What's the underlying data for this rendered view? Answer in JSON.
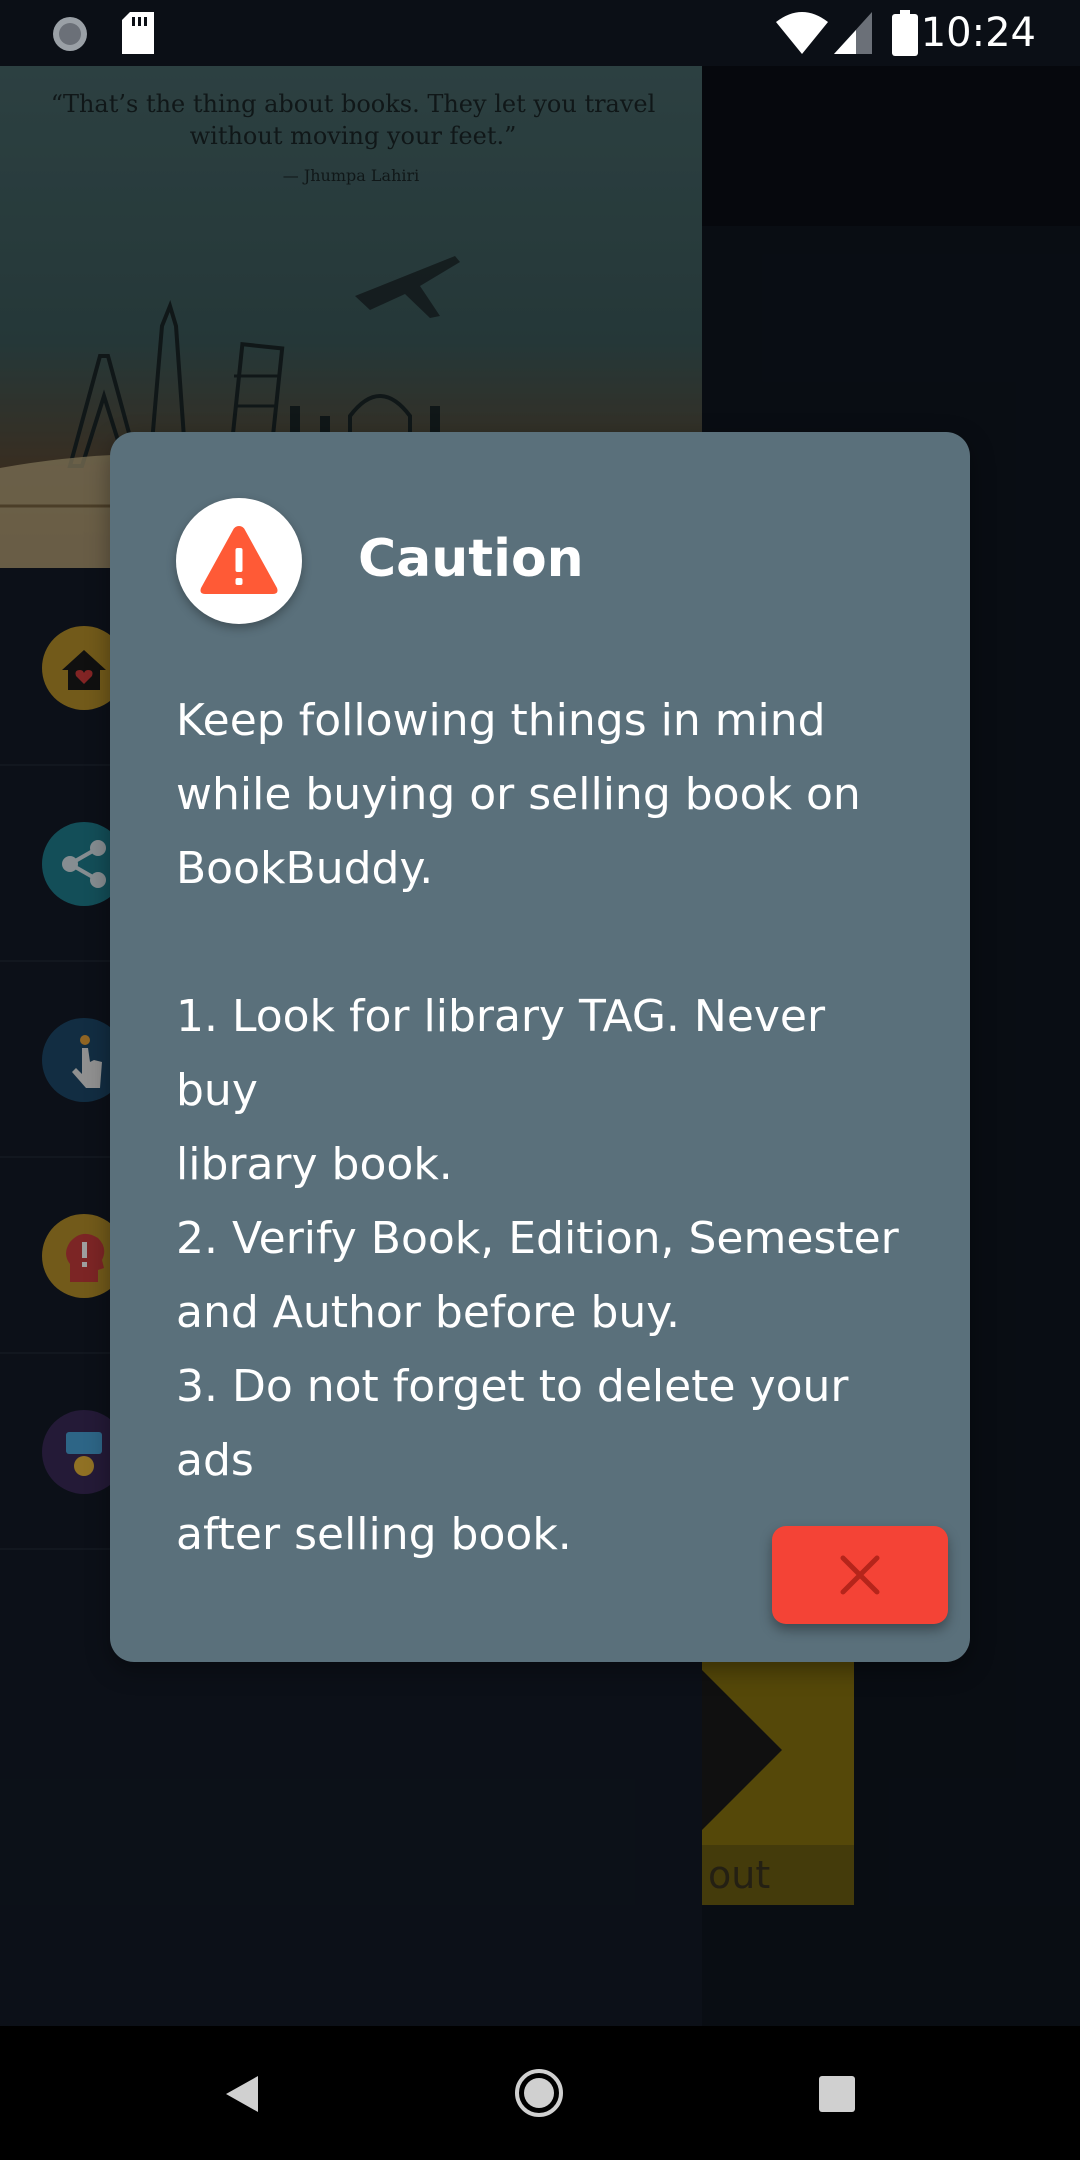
{
  "status_bar": {
    "time": "10:24",
    "icons": [
      "loading-spinner-icon",
      "sd-card-icon",
      "wifi-icon",
      "signal-icon",
      "battery-icon"
    ]
  },
  "drawer": {
    "quote": "“That’s the thing about books. They let you travel\nwithout moving your feet.”",
    "quote_author": "— Jhumpa Lahiri",
    "items": [
      {
        "icon": "home-heart-icon",
        "color": "#b8922a"
      },
      {
        "icon": "share-icon",
        "color": "#1f7f8f"
      },
      {
        "icon": "tap-hand-icon",
        "color": "#1d4a6b"
      },
      {
        "icon": "head-alert-icon",
        "color": "#b8922a"
      },
      {
        "icon": "feedback-icon",
        "color": "#3a2a5a"
      }
    ]
  },
  "background": {
    "card_label": "out"
  },
  "dialog": {
    "icon": "warning-icon",
    "title": "Caution",
    "body": "Keep following things in mind\nwhile buying or selling book on\nBookBuddy.\n\n1. Look for library TAG. Never buy\nlibrary book.\n2. Verify Book, Edition, Semester\nand Author before buy.\n3. Do not forget to delete your ads\nafter selling book.",
    "close_icon": "close-icon",
    "accent_color": "#f44336",
    "warning_color": "#ff5a36"
  },
  "nav_bar": {
    "icons": [
      "back-icon",
      "home-icon",
      "recents-icon"
    ]
  }
}
